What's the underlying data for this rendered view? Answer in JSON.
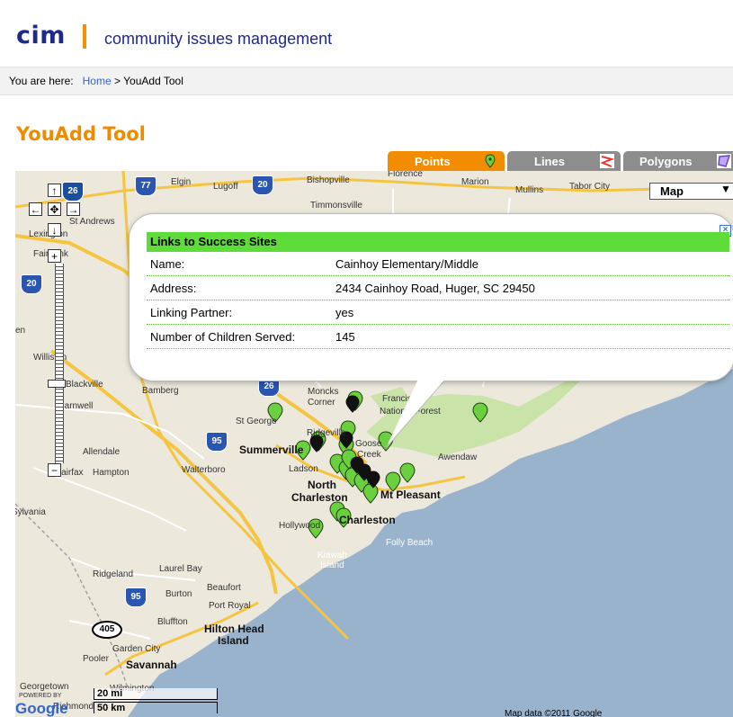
{
  "header": {
    "logo": "cim",
    "tagline": "community issues management"
  },
  "breadcrumb": {
    "prefix": "You are here:",
    "home": "Home",
    "separator": ">",
    "current": "YouAdd Tool"
  },
  "page": {
    "title": "YouAdd Tool"
  },
  "tabs": [
    {
      "label": "Points",
      "active": true,
      "icon": "green-marker-icon"
    },
    {
      "label": "Lines",
      "active": false,
      "icon": "line-icon"
    },
    {
      "label": "Polygons",
      "active": false,
      "icon": "polygon-icon"
    }
  ],
  "map": {
    "map_type": "Map",
    "scale_miles": "20 mi",
    "scale_km": "50 km",
    "copyright": "Map data ©2011 Google",
    "powered_by": "POWERED BY",
    "google": "Google",
    "places": {
      "elgin": "Elgin",
      "lugoff": "Lugoff",
      "bishopville": "Bishopville",
      "florence": "Florence",
      "marion": "Marion",
      "mullins": "Mullins",
      "tabor_city": "Tabor City",
      "timmonsville": "Timmonsville",
      "st_andrews": "St Andrews",
      "lexington": "Lexington",
      "fairbank": "Fairbank",
      "williston": "Williston",
      "blackville": "Blackville",
      "barnwell": "Barnwell",
      "bamberg": "Bamberg",
      "st_george": "St George",
      "summerville": "Summerville",
      "ridgeville": "Ridgeville",
      "goose_creek": "Goose",
      "creek": "Creek",
      "moncks_corner": "Moncks",
      "corner": "Corner",
      "francis_marion": "Francis M",
      "national_forest": "National Forest",
      "awendaw": "Awendaw",
      "ladson": "Ladson",
      "north_charleston": "North",
      "charleston_label": "Charleston",
      "mt_pleasant": "Mt Pleasant",
      "charleston": "Charleston",
      "hollywood": "Hollywood",
      "folly_beach": "Folly Beach",
      "kiawah": "Kiawah",
      "island": "Island",
      "allendale": "Allendale",
      "walterboro": "Walterboro",
      "fairfax": "Fairfax",
      "hampton": "Hampton",
      "sylvania": "Sylvania",
      "ridgeland": "Ridgeland",
      "laurel_bay": "Laurel Bay",
      "beaufort": "Beaufort",
      "burton": "Burton",
      "port_royal": "Port Royal",
      "bluffton": "Bluffton",
      "hilton_head": "Hilton Head",
      "hh_island": "Island",
      "garden_city": "Garden City",
      "pooler": "Pooler",
      "savannah": "Savannah",
      "georgetown": "Georgetown",
      "wilmington": "Wilmington",
      "richmond": "Richmond",
      "en": "en"
    },
    "shields": {
      "i26": "26",
      "i77": "77",
      "i20": "20",
      "i95": "95",
      "i95b": "95",
      "i26b": "26",
      "i95c": "95",
      "r405": "405"
    }
  },
  "popup": {
    "title": "Links to Success Sites",
    "rows": [
      {
        "label": "Name:",
        "value": "Cainhoy Elementary/Middle"
      },
      {
        "label": "Address:",
        "value": "2434 Cainhoy Road, Huger, SC 29450"
      },
      {
        "label": "Linking Partner:",
        "value": "yes"
      },
      {
        "label": "Number of Children Served:",
        "value": "145"
      }
    ]
  },
  "colors": {
    "accent": "#f28c00",
    "brand": "#1d2a8c",
    "popup_header": "#5ddc3a",
    "water": "#99b3cc",
    "land": "#ece8dc",
    "marker": "#6bd040"
  }
}
